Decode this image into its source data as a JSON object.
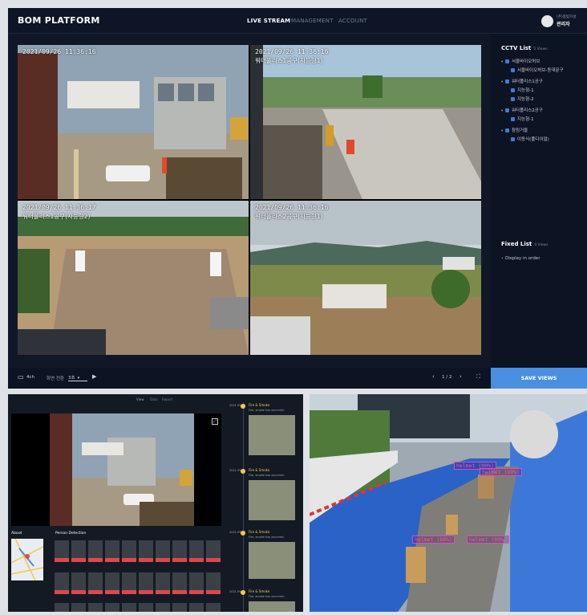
{
  "app": {
    "brand": "BOM PLATFORM",
    "nav": [
      {
        "label": "LIVE STREAM",
        "active": true
      },
      {
        "label": "MANAGEMENT",
        "active": false
      },
      {
        "label": "ACCOUNT",
        "active": false
      }
    ],
    "user": {
      "org": "(주)봄빛가설",
      "name": "관리자"
    }
  },
  "cameras": [
    {
      "timestamp": "2021/09/26 11:36:16",
      "label": "",
      "top_text": "2021/09/26 11:36:16"
    },
    {
      "timestamp": "2021/09/26 11:36:16",
      "label": "워터폴리스1공구(지능형1)"
    },
    {
      "timestamp": "2021/09/26 11:36:17",
      "label": "워터폴리스1공구(지능형2)"
    },
    {
      "timestamp": "2021/09/26 11:36:16",
      "label": "워터폴리스2공구(지능형1)"
    }
  ],
  "sidebar": {
    "cctv_title": "CCTV List",
    "cctv_count": "5 Views",
    "tree": [
      {
        "label": "서울바이오허브",
        "level": 0
      },
      {
        "label": "서울바이오허브-동대문구",
        "level": 1
      },
      {
        "label": "워터폴리스1공구",
        "level": 0
      },
      {
        "label": "지능형-1",
        "level": 1
      },
      {
        "label": "지능형-2",
        "level": 1
      },
      {
        "label": "워터폴리스2공구",
        "level": 0
      },
      {
        "label": "지능형-1",
        "level": 1
      },
      {
        "label": "참림거울",
        "level": 0
      },
      {
        "label": "이동식(풀다이얼)",
        "level": 1
      }
    ],
    "fixed_title": "Fixed List",
    "fixed_count": "0 Views",
    "fixed_item": "Display in order"
  },
  "bottombar": {
    "channels": "4ch",
    "rotate_label": "화면 전환",
    "rotate_value": "3초",
    "pager": "1 / 2",
    "save": "SAVE VIEWS"
  },
  "panel2": {
    "tabs": [
      "View",
      "Data",
      "Report"
    ],
    "about": "About",
    "person_detection": "Person Detection",
    "events": [
      {
        "time": "2021.09.26",
        "title": "Fire & Smoke",
        "desc": "Fire, smoke has occurred."
      },
      {
        "time": "2021.09.26",
        "title": "Fire & Smoke",
        "desc": "Fire, smoke has occurred."
      },
      {
        "time": "2021.09.26",
        "title": "Fire & Smoke",
        "desc": "Fire, smoke has occurred."
      },
      {
        "time": "2021.09.26",
        "title": "Fire & Smoke",
        "desc": "Fire, smoke has occurred."
      }
    ]
  },
  "detections": [
    "helmet (90%)",
    "helmet (80%)",
    "helmet (88%)",
    "helmet (80%)"
  ],
  "colors": {
    "accent": "#4a8fe0",
    "bg": "#101827",
    "tag": "#ff4fb8"
  }
}
